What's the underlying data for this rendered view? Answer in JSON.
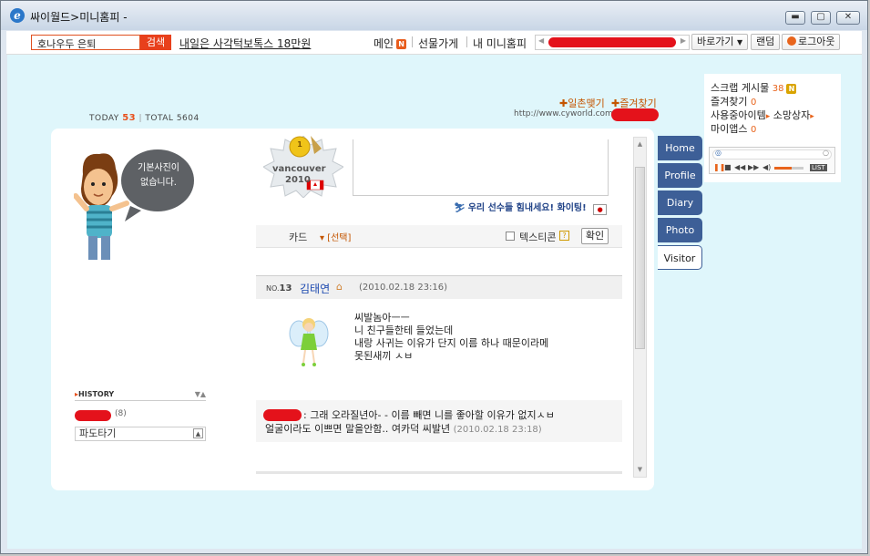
{
  "window": {
    "title": "싸이월드>미니홈피 -",
    "icon": "ie-icon",
    "controls": [
      "minimize-icon",
      "maximize-icon",
      "close-icon"
    ]
  },
  "toolbar": {
    "search_value": "호나우두 은퇴",
    "search_button": "검색",
    "headline": "내일은 사각턱보톡스 18만원",
    "nav_main": "메인",
    "nav_main_badge": "N",
    "nav_gift": "선물가게",
    "nav_myhome": "내 미니홈피",
    "goto": "바로가기",
    "random": "랜덤",
    "logout": "로그아웃"
  },
  "colors": {
    "accent": "#e8401c",
    "background": "#dff6fb",
    "tab": "#3d5f97",
    "link": "#1d4ab0"
  },
  "counter": {
    "today_label": "TODAY",
    "today": "53",
    "total_label": "TOTAL",
    "total": "5604"
  },
  "top_links": {
    "ilchon": "일촌맺기",
    "favorite": "즐겨찾기"
  },
  "url_prefix": "http://www.cyworld.com/",
  "profile": {
    "default_photo_text_1": "기본사진이",
    "default_photo_text_2": "없습니다."
  },
  "history": {
    "title": "HISTORY",
    "count": "(8)",
    "item": "파도타기"
  },
  "olympic": {
    "line1": "vancouver",
    "line2": "2010",
    "medal": "1",
    "cheer": "우리 선수들 힘내세요! 화이팅!"
  },
  "card": {
    "label": "카드",
    "select": "[선택]",
    "emoticon": "텍스티콘",
    "help": "?",
    "confirm": "확인"
  },
  "post": {
    "no_label": "NO.",
    "no": "13",
    "author": "김태연",
    "date": "(2010.02.18 23:16)",
    "lines": [
      "씨발놈아ㅡㅡ",
      "니 친구들한테 들었는데",
      "내랑 사귀는 이유가 단지 이름 하나 때문이라메",
      "못된새끼 ㅅㅂ"
    ]
  },
  "reply": {
    "text_1": ": 그래 오라질년아- - 이름 빼면 니를 좋아할 이유가 없지ㅅㅂ",
    "text_2": "얼굴이라도 이쁘면 말을안함.. 여카덕 씨발년",
    "date": "(2010.02.18 23:18)"
  },
  "tabs": [
    "Home",
    "Profile",
    "Diary",
    "Photo",
    "Visitor"
  ],
  "active_tab": "Visitor",
  "right_panel": {
    "scrap": "스크랩 게시물",
    "scrap_count": "38",
    "scrap_badge": "N",
    "fav": "즐겨찾기",
    "fav_count": "0",
    "items": "사용중아이템",
    "wish": "소망상자",
    "apps": "마이앱스",
    "apps_count": "0",
    "player_list": "LIST"
  }
}
